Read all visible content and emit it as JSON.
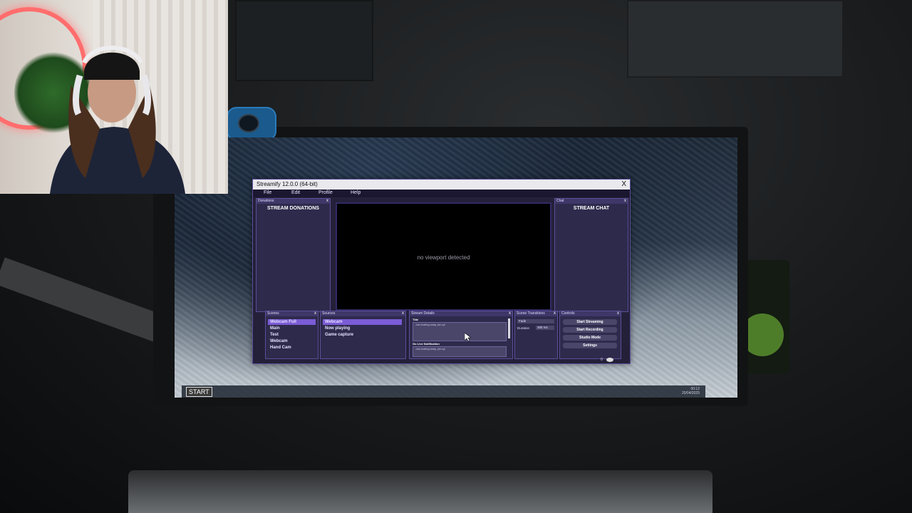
{
  "app": {
    "title": "Streamify 12.0.0 (64-bit)",
    "close_glyph": "X",
    "menu": [
      "File",
      "Edit",
      "Profile",
      "Help"
    ]
  },
  "donations": {
    "header": "Donations",
    "title": "STREAM DONATIONS",
    "close_glyph": "x"
  },
  "chat": {
    "header": "Chat",
    "title": "STREAM CHAT",
    "close_glyph": "x"
  },
  "viewport": {
    "message": "no viewport detected"
  },
  "scenes": {
    "header": "Scenes",
    "close_glyph": "x",
    "items": [
      "Webcam Full",
      "Main",
      "Test",
      "Webcam",
      "Hand Cam"
    ],
    "selected_index": 0
  },
  "sources": {
    "header": "Sources",
    "close_glyph": "x",
    "items": [
      "Webcam",
      "Now playing",
      "Game capture"
    ],
    "selected_index": 0
  },
  "stream_details": {
    "header": "Stream Details",
    "close_glyph": "x",
    "title_label": "Title",
    "title_value": "Just chatting today, join up!",
    "notification_label": "Go Live Notification",
    "notification_value": "Just chatting today, join up!"
  },
  "scene_transitions": {
    "header": "Scene Transitions",
    "close_glyph": "x",
    "transition_value": "Fade",
    "duration_label": "Duration",
    "duration_value": "300 ms"
  },
  "controls": {
    "header": "Controls",
    "close_glyph": "x",
    "buttons": [
      "Start Streaming",
      "Start Recording",
      "Studio Mode",
      "Settings"
    ]
  },
  "status": {
    "viewer_count": "0"
  },
  "taskbar": {
    "start_label": "START",
    "time": "00:12",
    "date": "20/04/2025"
  },
  "colors": {
    "accent": "#7b5cd6",
    "panel": "#2e2a4c",
    "border": "#5b4f9a"
  }
}
